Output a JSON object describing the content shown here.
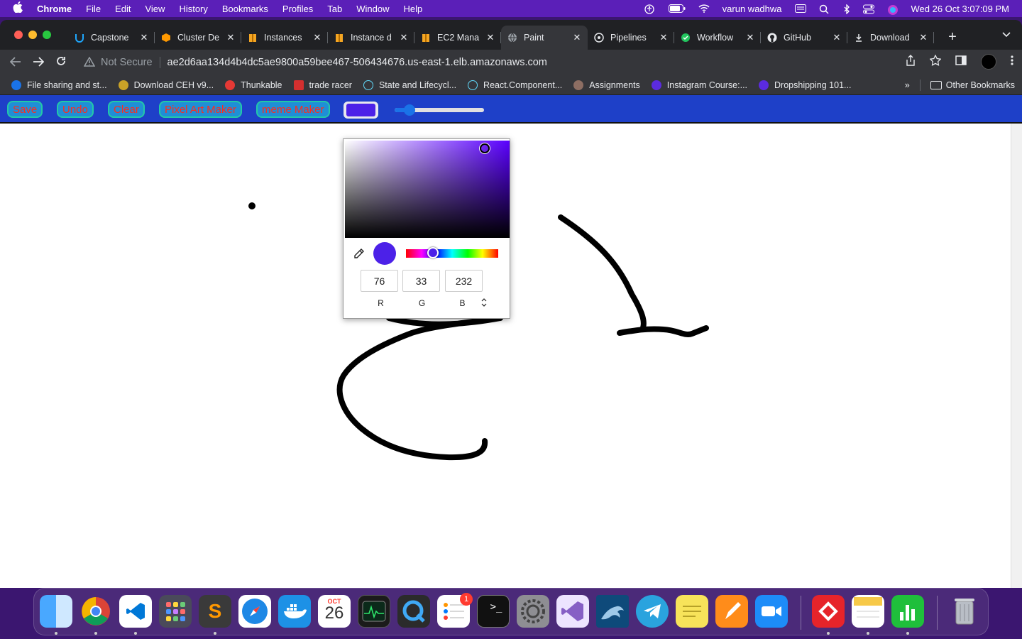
{
  "menubar": {
    "app": "Chrome",
    "items": [
      "File",
      "Edit",
      "View",
      "History",
      "Bookmarks",
      "Profiles",
      "Tab",
      "Window",
      "Help"
    ],
    "user": "varun wadhwa",
    "datetime": "Wed 26 Oct  3:07:09 PM"
  },
  "tabs": [
    {
      "label": "Capstone",
      "icon": "capstone-icon",
      "color": "#1ea7fd"
    },
    {
      "label": "Cluster De",
      "icon": "aws-icon",
      "color": "#ff9900"
    },
    {
      "label": "Instances",
      "icon": "ec2-icon",
      "color": "#f5a623"
    },
    {
      "label": "Instance d",
      "icon": "ec2-icon",
      "color": "#f5a623"
    },
    {
      "label": "EC2 Mana",
      "icon": "ec2-icon",
      "color": "#f5a623"
    },
    {
      "label": "Paint",
      "icon": "globe-icon",
      "color": "#9aa0a6",
      "active": true
    },
    {
      "label": "Pipelines",
      "icon": "pipeline-icon",
      "color": "#e8eaed"
    },
    {
      "label": "Workflow",
      "icon": "workflow-icon",
      "color": "#22c55e"
    },
    {
      "label": "GitHub",
      "icon": "github-icon",
      "color": "#e8eaed"
    },
    {
      "label": "Download",
      "icon": "download-icon",
      "color": "#e8eaed"
    }
  ],
  "omnibox": {
    "security": "Not Secure",
    "url": "ae2d6aa134d4b4dc5ae9800a59bee467-506434676.us-east-1.elb.amazonaws.com"
  },
  "bookmarks": [
    {
      "label": "File sharing and st...",
      "color": "#1a73e8"
    },
    {
      "label": "Download CEH v9...",
      "color": "#c9a227"
    },
    {
      "label": "Thunkable",
      "color": "#e53935"
    },
    {
      "label": "trade racer",
      "color": "#d32f2f"
    },
    {
      "label": "State and Lifecycl...",
      "color": "#61dafb"
    },
    {
      "label": "React.Component...",
      "color": "#61dafb"
    },
    {
      "label": "Assignments",
      "color": "#8d6e63"
    },
    {
      "label": "Instagram Course:...",
      "color": "#5b2be0"
    },
    {
      "label": "Dropshipping 101...",
      "color": "#5b2be0"
    }
  ],
  "bookmarks_other": "Other Bookmarks",
  "app": {
    "buttons": {
      "save": "Save",
      "undo": "Undo",
      "clear": "Clear",
      "pixel_art": "Pixel Art Maker",
      "meme": "meme Maker"
    },
    "selected_color": "#4c21e8",
    "brush_size_fraction": 0.17
  },
  "picker": {
    "r": "76",
    "g": "33",
    "b": "232",
    "r_label": "R",
    "g_label": "G",
    "b_label": "B"
  },
  "dock": {
    "calendar_month": "OCT",
    "calendar_day": "26",
    "reminders_badge": "1"
  }
}
